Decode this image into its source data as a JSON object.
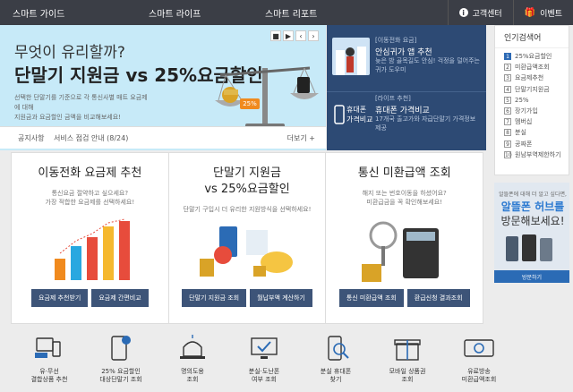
{
  "nav": {
    "items": [
      "스마트 가이드",
      "스마트 라이프",
      "스마트 리포트"
    ],
    "right": [
      "고객센터",
      "이벤트"
    ]
  },
  "hero": {
    "line1": "무엇이 유리할까?",
    "line2": "단말기 지원금 vs 25%요금할인",
    "desc1": "선택한 단말기를 기준으로 각 통신사별 매트 요금제에 대해",
    "desc2": "지원금과 요금할인 금액을 비교해보세요!",
    "badge": "25%"
  },
  "notice": {
    "label": "공지사항",
    "text": "서비스 점검 안내 (8/24)",
    "more": "더보기 +"
  },
  "bluepanel": {
    "row1": {
      "tag": "[이동전화 요금]",
      "title": "안심귀가 앱 추천",
      "sub": "늦은 밤 골목길도 안심! 걱정을 덜어주는 귀가 도우미"
    },
    "row2": {
      "tag": "[라이프 추천]",
      "title": "휴대폰 가격비교",
      "sub": "17개국 출고가와 자급단말기 가격정보 제공",
      "img_label": "휴대폰 가격비교"
    }
  },
  "sidebar": {
    "title": "인기검색어",
    "items": [
      "25%요금할인",
      "미환급액조회",
      "요금제추천",
      "단말기지원금",
      "25%",
      "장기가입",
      "멤버십",
      "분실",
      "공짜폰",
      "원남부역제한하기"
    ]
  },
  "ad": {
    "l1": "알뜰폰에 대해 더 알고 싶다면,",
    "l2": "알뜰폰 허브를",
    "l3": "방문해보세요!",
    "btn": "방문하기"
  },
  "cards": [
    {
      "title": "이동전화 요금제 추천",
      "desc": "통신요금 절약하고 싶으세요?\n가장 적합한 요금제를 선택하세요!",
      "buttons": [
        "요금제 추천받기",
        "요금제 간편비교"
      ]
    },
    {
      "title": "단말기 지원금\nvs 25%요금할인",
      "desc": "단말기 구입시 더 유리한 지원방식을 선택하세요!",
      "buttons": [
        "단말기 지원금 조회",
        "월납부액 계산하기"
      ]
    },
    {
      "title": "통신 미환급액 조회",
      "desc": "해지 또는 번호이동을 하셨어요?\n미환급금을 꼭 확인해보세요!",
      "buttons": [
        "통신 미환급액 조회",
        "환급신청 결과조회"
      ]
    }
  ],
  "bottom": [
    {
      "icon": "combo-icon",
      "label": "유·무선\n결합상품 추천"
    },
    {
      "icon": "discount-phone-icon",
      "label": "25% 요금할인\n대상단말기 조회"
    },
    {
      "icon": "alarm-icon",
      "label": "명의도용\n조회"
    },
    {
      "icon": "monitor-check-icon",
      "label": "분실·도난폰\n여부 조회"
    },
    {
      "icon": "phone-search-icon",
      "label": "분실 휴대폰\n찾기"
    },
    {
      "icon": "gift-icon",
      "label": "모바일 상품권\n조회"
    },
    {
      "icon": "lost-money-icon",
      "label": "유료방송\n미환급액조회"
    }
  ]
}
